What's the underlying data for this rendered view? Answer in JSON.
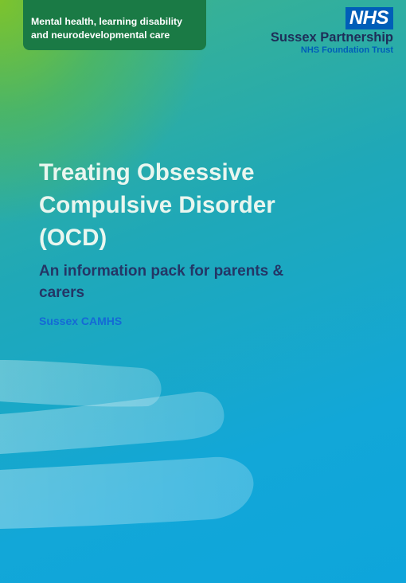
{
  "header": {
    "service_lines": [
      "Mental health, learning disability",
      "and neurodevelopmental care"
    ],
    "logo_text": "NHS",
    "organisation": "Sussex Partnership",
    "trust": "NHS Foundation Trust"
  },
  "cover": {
    "title_lines": [
      "Treating Obsessive",
      "Compulsive Disorder",
      "(OCD)"
    ],
    "subtitle_lines": [
      "An information pack for parents &",
      "carers"
    ],
    "organisation_unit": "Sussex CAMHS"
  },
  "colors": {
    "banner": "#1a7a45",
    "nhs_blue": "#005eb8",
    "navy": "#1e2d58",
    "title": "#e9f6ef",
    "unit": "#1469d6"
  }
}
